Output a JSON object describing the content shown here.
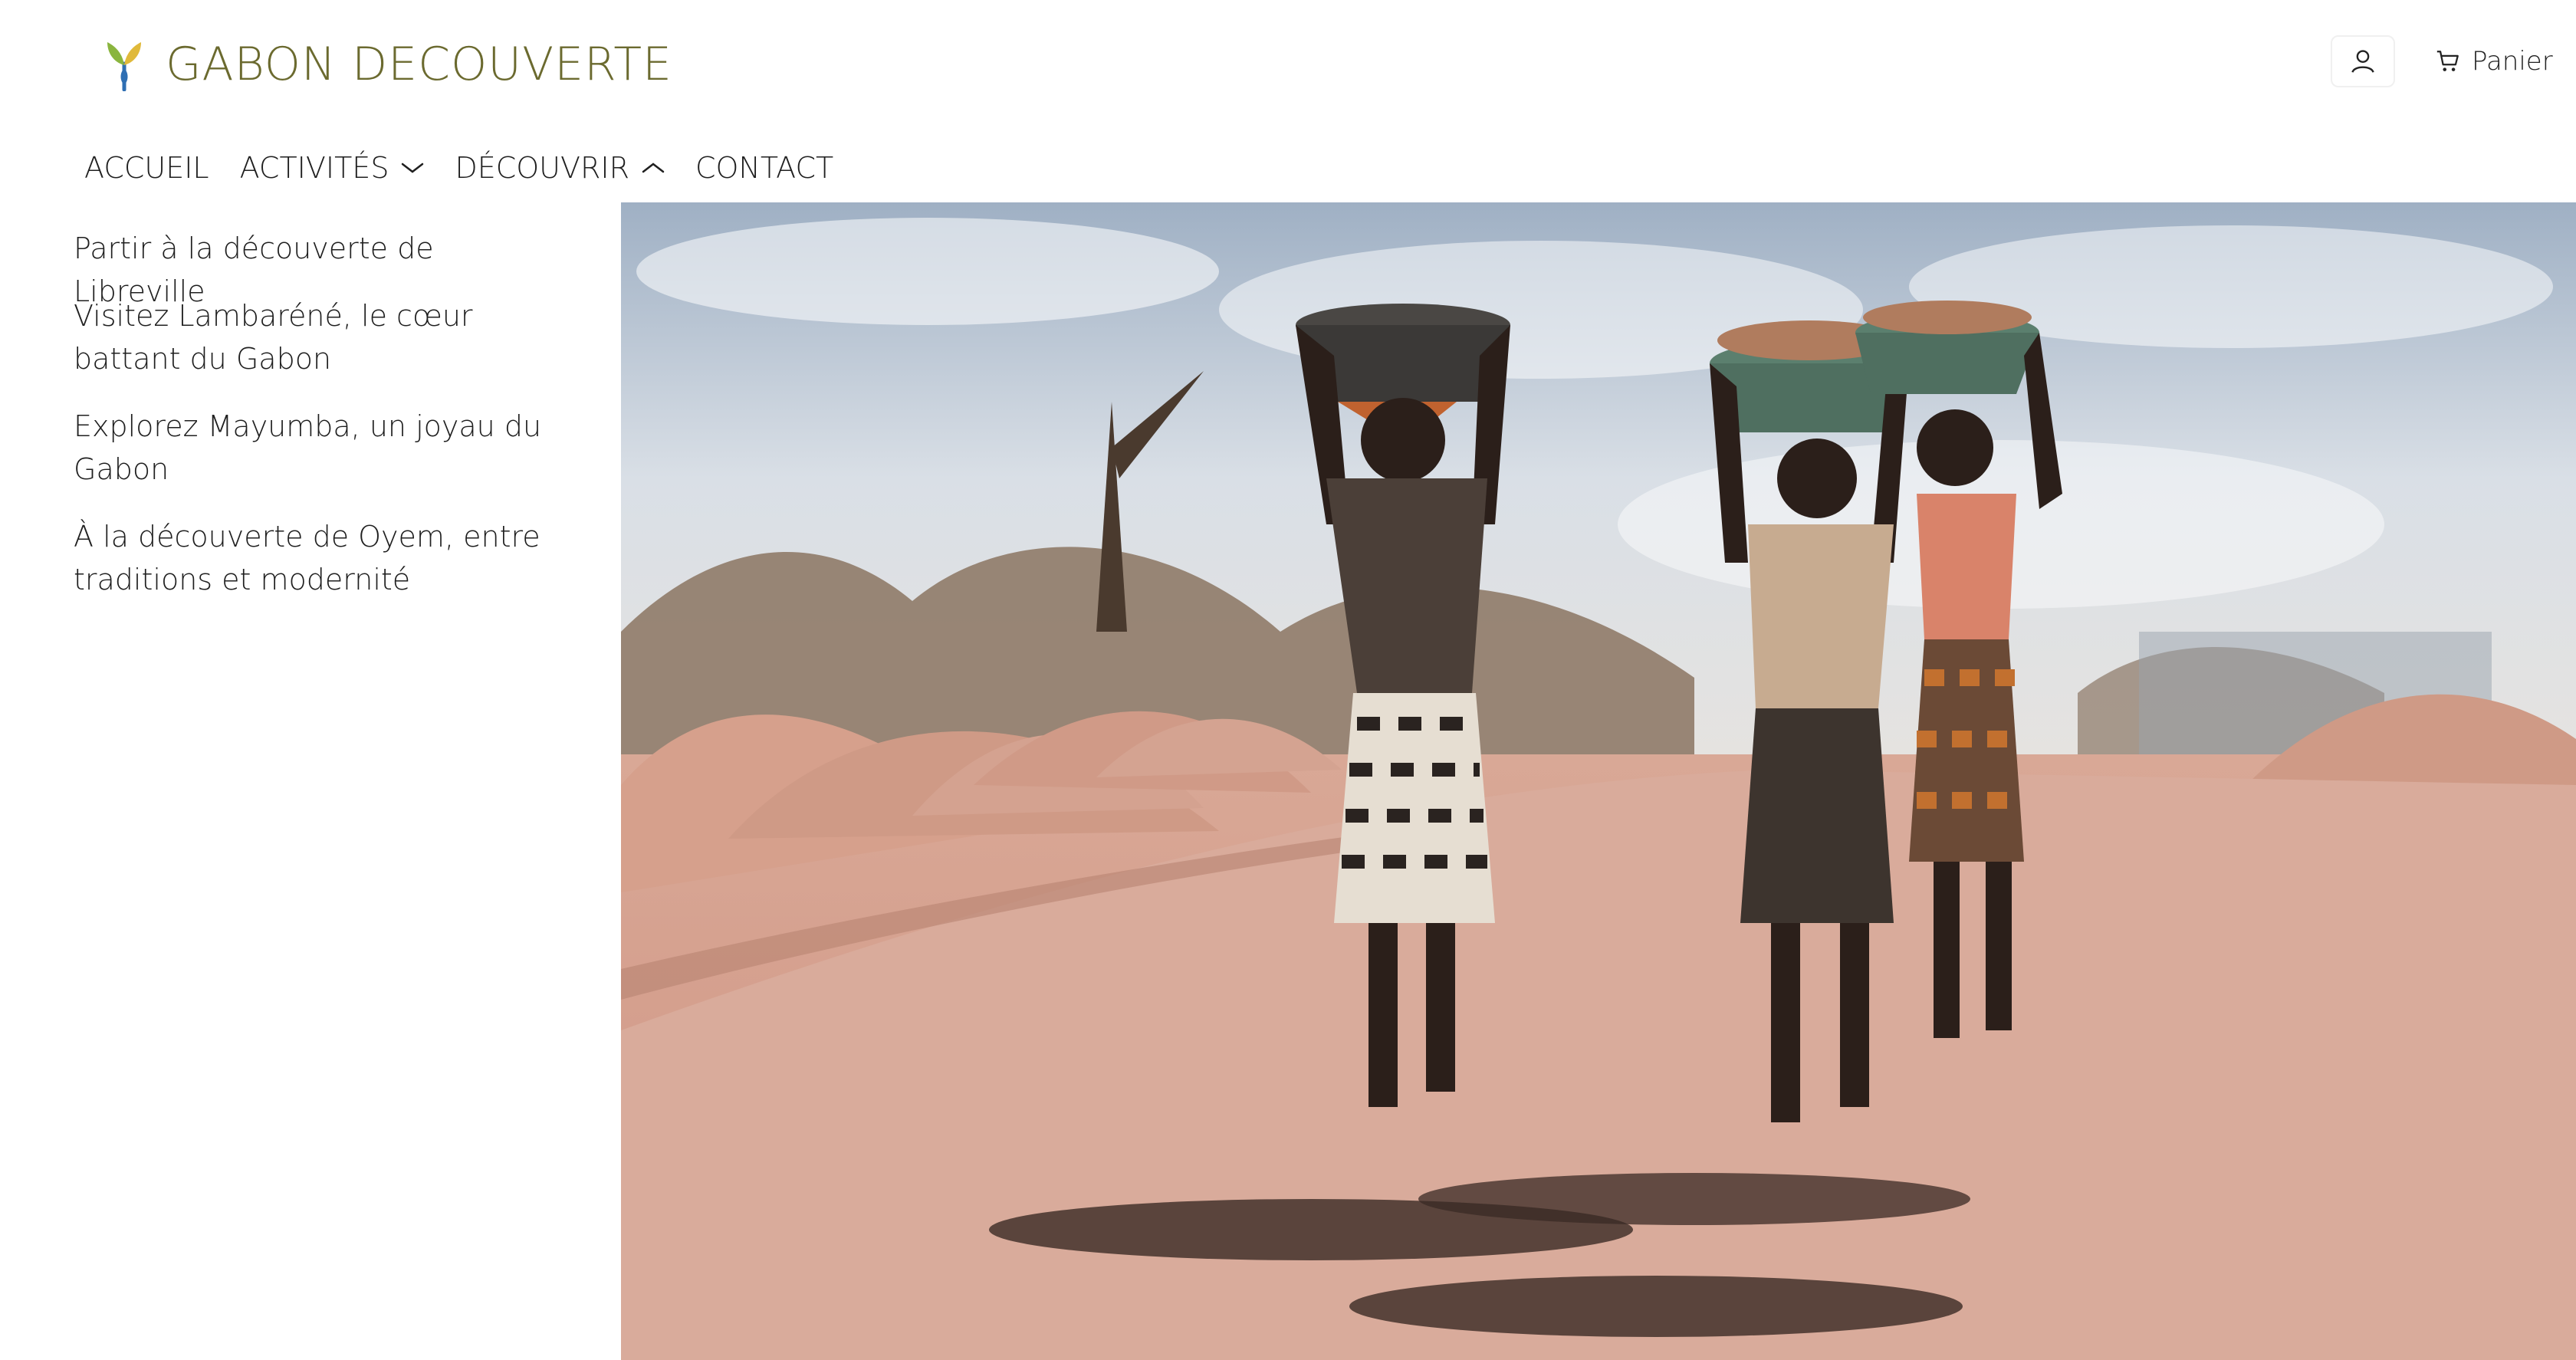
{
  "brand": {
    "name": "GABON DECOUVERTE",
    "icon": "leaf-logo-icon",
    "colors": {
      "text": "#6b6a2f",
      "leaf_green": "#8ab53e",
      "leaf_gold": "#e0b93a",
      "leaf_blue": "#2f6fb3"
    }
  },
  "header": {
    "account_icon": "user-icon",
    "cart_icon": "cart-icon",
    "cart_label": "Panier"
  },
  "nav": {
    "items": [
      {
        "label": "ACCUEIL",
        "has_dropdown": false
      },
      {
        "label": "ACTIVITÉS",
        "has_dropdown": true,
        "chevron": "chevron-down-icon"
      },
      {
        "label": "DÉCOUVRIR",
        "has_dropdown": true,
        "chevron": "chevron-up-icon",
        "expanded": true
      },
      {
        "label": "CONTACT",
        "has_dropdown": false
      }
    ]
  },
  "dropdown": {
    "items": [
      {
        "label": "Partir à la découverte de Libreville"
      },
      {
        "label": "Visitez Lambaréné, le cœur battant du Gabon"
      },
      {
        "label": "Explorez Mayumba, un joyau du Gabon"
      },
      {
        "label": "À la découverte de Oyem, entre traditions et modernité"
      }
    ]
  },
  "hero": {
    "image_subject": "three-women-carrying-basins-on-dirt-road"
  }
}
